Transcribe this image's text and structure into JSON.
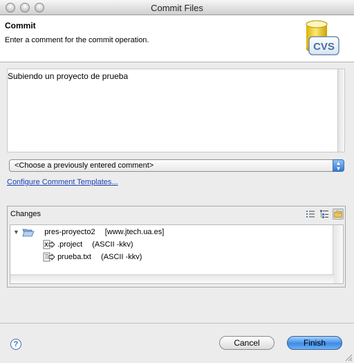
{
  "window": {
    "title": "Commit Files"
  },
  "header": {
    "title": "Commit",
    "message": "Enter a comment for the commit operation.",
    "logo_text": "CVS"
  },
  "comment": {
    "value": "Subiendo un proyecto de prueba"
  },
  "previous_comments": {
    "selected": "<Choose a previously entered comment>"
  },
  "templates_link": "Configure Comment Templates...",
  "changes": {
    "title": "Changes",
    "toolbar": [
      {
        "icon": "flat-list-icon"
      },
      {
        "icon": "tree-view-icon"
      },
      {
        "icon": "compressed-folders-icon"
      }
    ],
    "project": {
      "name": "pres-proyecto2",
      "repo": "[www.jtech.ua.es]"
    },
    "files": [
      {
        "name": ".project",
        "mode": "(ASCII -kkv)"
      },
      {
        "name": "prueba.txt",
        "mode": "(ASCII -kkv)"
      }
    ]
  },
  "buttons": {
    "help": "?",
    "cancel": "Cancel",
    "finish": "Finish"
  },
  "colors": {
    "link": "#1a3fb3",
    "accent": "#3d8ce6"
  }
}
